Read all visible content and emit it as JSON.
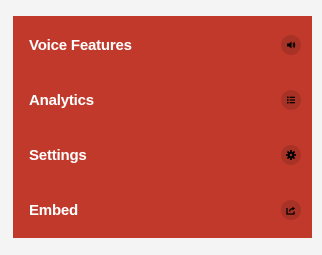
{
  "menu": {
    "items": [
      {
        "label": "Voice Features",
        "icon": "volume-icon"
      },
      {
        "label": "Analytics",
        "icon": "list-icon"
      },
      {
        "label": "Settings",
        "icon": "gear-icon"
      },
      {
        "label": "Embed",
        "icon": "share-icon"
      }
    ]
  },
  "colors": {
    "background": "#f4f4f4",
    "menu_background": "#c0392b",
    "icon_background": "#a93226",
    "text": "#ffffff"
  }
}
